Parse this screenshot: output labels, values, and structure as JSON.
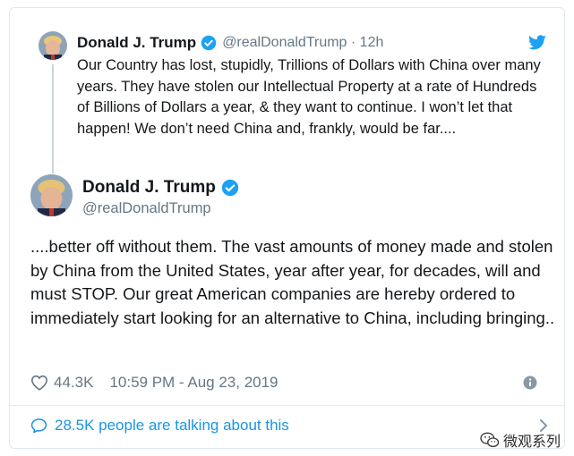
{
  "parent_tweet": {
    "name": "Donald J. Trump",
    "handle": "@realDonaldTrump",
    "separator": " · ",
    "time": "12h",
    "text": "Our Country has lost, stupidly, Trillions of Dollars with China over many years. They have stolen our Intellectual Property at a rate of Hundreds of Billions of Dollars a year, & they want to continue. I won’t let that happen! We don’t need China and, frankly, would be far...."
  },
  "main_tweet": {
    "name": "Donald J. Trump",
    "handle": "@realDonaldTrump",
    "text": "....better off without them. The vast amounts of money made and stolen by China from the United States, year after year, for decades, will and must STOP. Our great American companies are hereby ordered to immediately start looking for an alternative to China, including bringing..",
    "likes": "44.3K",
    "timestamp": "10:59 PM - Aug 23, 2019"
  },
  "footer": {
    "talking": "28.5K people are talking about this"
  },
  "watermark": {
    "text": "微观系列"
  },
  "colors": {
    "twitter_blue": "#1da1f2",
    "link_blue": "#1b95e0",
    "secondary_text": "#657786",
    "primary_text": "#14171a",
    "border": "#e1e8ed"
  },
  "icons": [
    "verified-badge-icon",
    "twitter-bird-icon",
    "heart-icon",
    "info-icon",
    "speech-bubble-icon",
    "chevron-right-icon"
  ]
}
